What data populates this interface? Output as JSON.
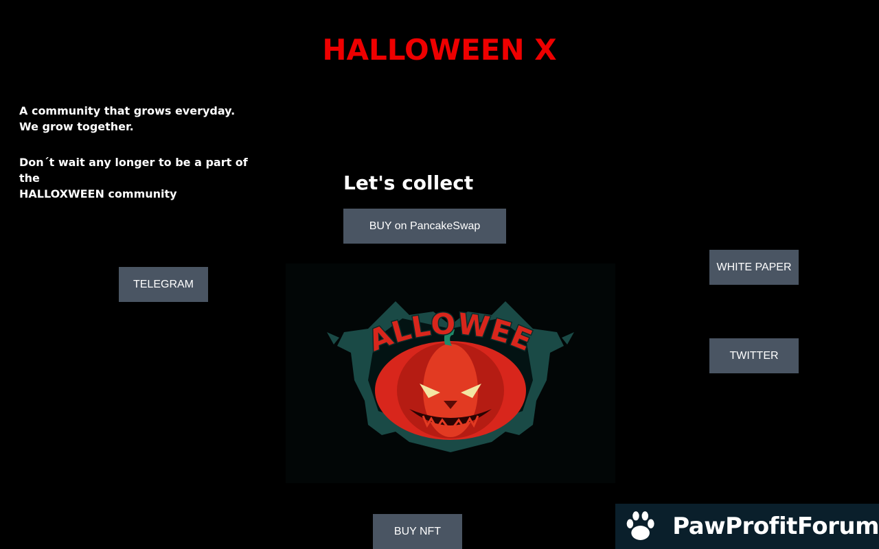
{
  "header": {
    "title": "HALLOWEEN X",
    "title_color": "#ee0000"
  },
  "intro": {
    "line1": "A community that grows everyday.",
    "line2": "We grow together.",
    "line3": "Don´t wait any longer to be a part of the",
    "line4": "HALLOXWEEN community"
  },
  "collect": {
    "heading": "Let's collect"
  },
  "buttons": {
    "buy_pancakeswap": "BUY on PancakeSwap",
    "telegram": "TELEGRAM",
    "white_paper": "WHITE PAPER",
    "twitter": "TWITTER",
    "buy_nft": "BUY NFT",
    "color": "#4a5563"
  },
  "hero_image": {
    "logo_text": "HALLOWEEN",
    "icon": "pumpkin-logo-icon",
    "logo_red": "#d8261c",
    "logo_teal": "#1a4a46"
  },
  "watermark": {
    "text": "PawProfitForum",
    "icon": "paw-icon",
    "background": "#0a1f2b"
  }
}
